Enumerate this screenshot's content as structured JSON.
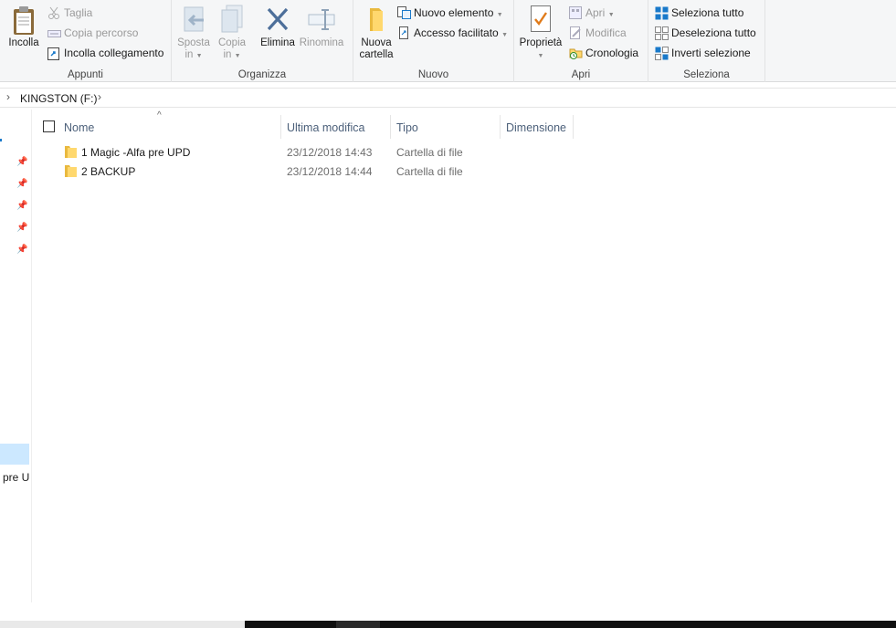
{
  "ribbon": {
    "appunti": {
      "group_label": "Appunti",
      "incolla": "Incolla",
      "taglia": "Taglia",
      "copia_percorso": "Copia percorso",
      "incolla_collegamento": "Incolla collegamento"
    },
    "organizza": {
      "group_label": "Organizza",
      "sposta_line1": "Sposta",
      "sposta_line2": "in",
      "copia_line1": "Copia",
      "copia_line2": "in",
      "elimina": "Elimina",
      "rinomina": "Rinomina"
    },
    "nuovo": {
      "group_label": "Nuovo",
      "nuova_cartella_line1": "Nuova",
      "nuova_cartella_line2": "cartella",
      "nuovo_elemento": "Nuovo elemento",
      "accesso_facilitato": "Accesso facilitato"
    },
    "apri": {
      "group_label": "Apri",
      "proprieta": "Proprietà",
      "apri": "Apri",
      "modifica": "Modifica",
      "cronologia": "Cronologia"
    },
    "seleziona": {
      "group_label": "Seleziona",
      "seleziona_tutto": "Seleziona tutto",
      "deseleziona_tutto": "Deseleziona tutto",
      "inverti_selezione": "Inverti selezione"
    }
  },
  "address": {
    "crumb": "KINGSTON (F:)"
  },
  "nav": {
    "truncated_item": "pre U"
  },
  "columns": {
    "name": "Nome",
    "modified": "Ultima modifica",
    "type": "Tipo",
    "size": "Dimensione"
  },
  "files": [
    {
      "name": "1 Magic -Alfa pre UPD",
      "modified": "23/12/2018 14:43",
      "type": "Cartella di file"
    },
    {
      "name": "2 BACKUP",
      "modified": "23/12/2018 14:44",
      "type": "Cartella di file"
    }
  ],
  "colors": {
    "ribbon_bg": "#f5f6f7",
    "selection": "#cce8ff",
    "accent_blue": "#1979ca",
    "folder_yellow": "#ffd86e"
  }
}
